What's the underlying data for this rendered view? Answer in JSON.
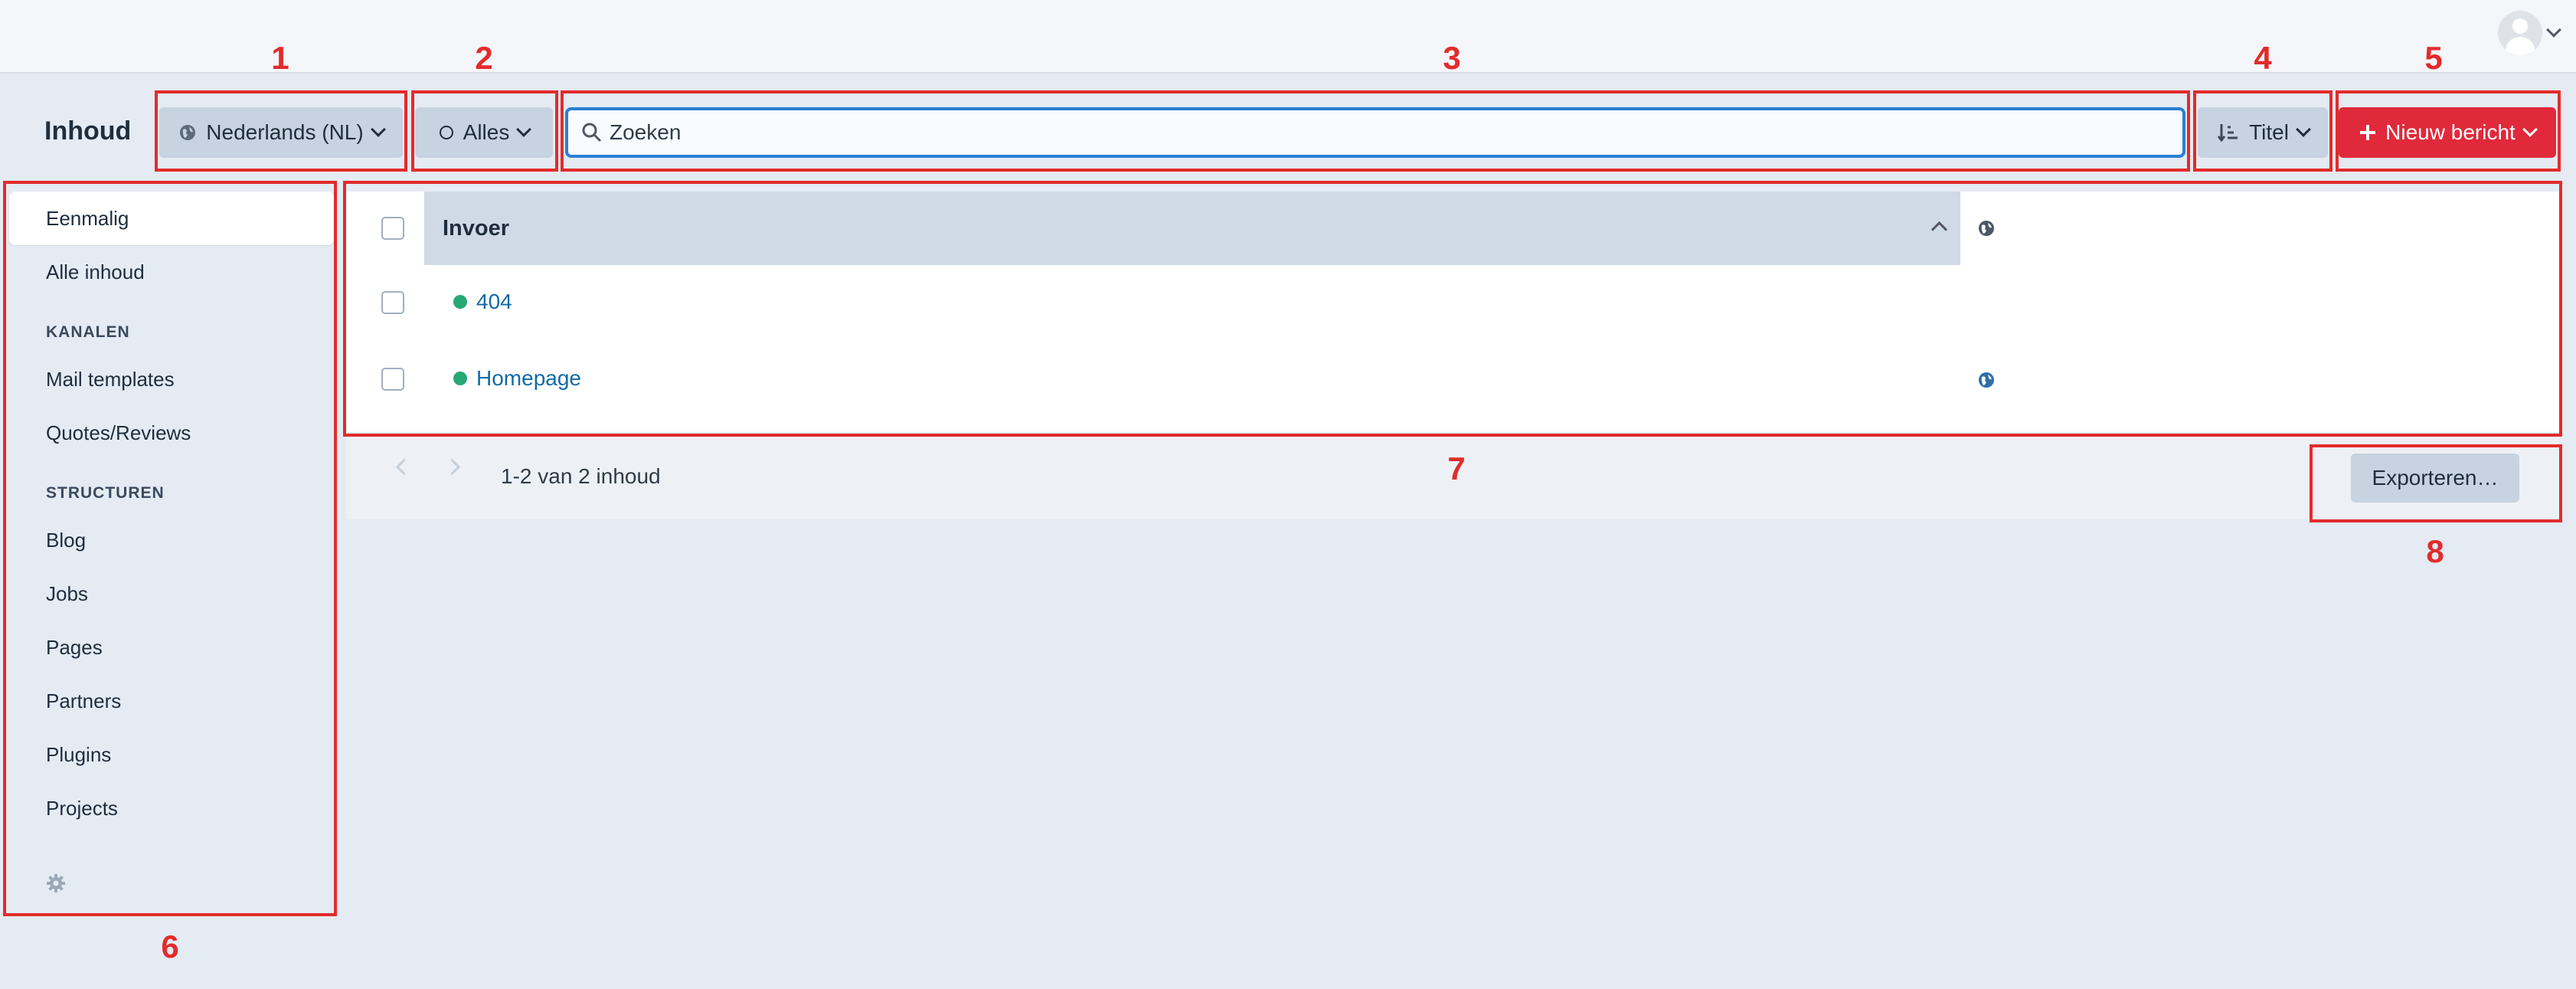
{
  "header": {
    "user_icon": "user-avatar-icon"
  },
  "toolbar": {
    "title": "Inhoud",
    "locale_label": "Nederlands (NL)",
    "status_label": "Alles",
    "search_placeholder": "Zoeken",
    "sort_label": "Titel",
    "new_label": "Nieuw bericht",
    "new_color": "#e0293a"
  },
  "annotations": [
    "1",
    "2",
    "3",
    "4",
    "5",
    "6",
    "7",
    "8"
  ],
  "sidebar": {
    "items": [
      {
        "label": "Eenmalig"
      },
      {
        "label": "Alle inhoud"
      }
    ],
    "channels_heading": "KANALEN",
    "channels": [
      {
        "label": "Mail templates"
      },
      {
        "label": "Quotes/Reviews"
      }
    ],
    "structures_heading": "STRUCTUREN",
    "structures": [
      {
        "label": "Blog"
      },
      {
        "label": "Jobs"
      },
      {
        "label": "Pages"
      },
      {
        "label": "Partners"
      },
      {
        "label": "Plugins"
      },
      {
        "label": "Projects"
      }
    ]
  },
  "table": {
    "column_header": "Invoer",
    "rows": [
      {
        "title": "404",
        "status_color": "#27a874",
        "has_locale_icon": false
      },
      {
        "title": "Homepage",
        "status_color": "#27a874",
        "has_locale_icon": true
      }
    ]
  },
  "footer": {
    "pagination_text": "1-2 van 2 inhoud",
    "export_label": "Exporteren…"
  },
  "colors": {
    "annotation": "#e32b2b",
    "link": "#126aa6",
    "search_focus": "#2a7fd4"
  }
}
